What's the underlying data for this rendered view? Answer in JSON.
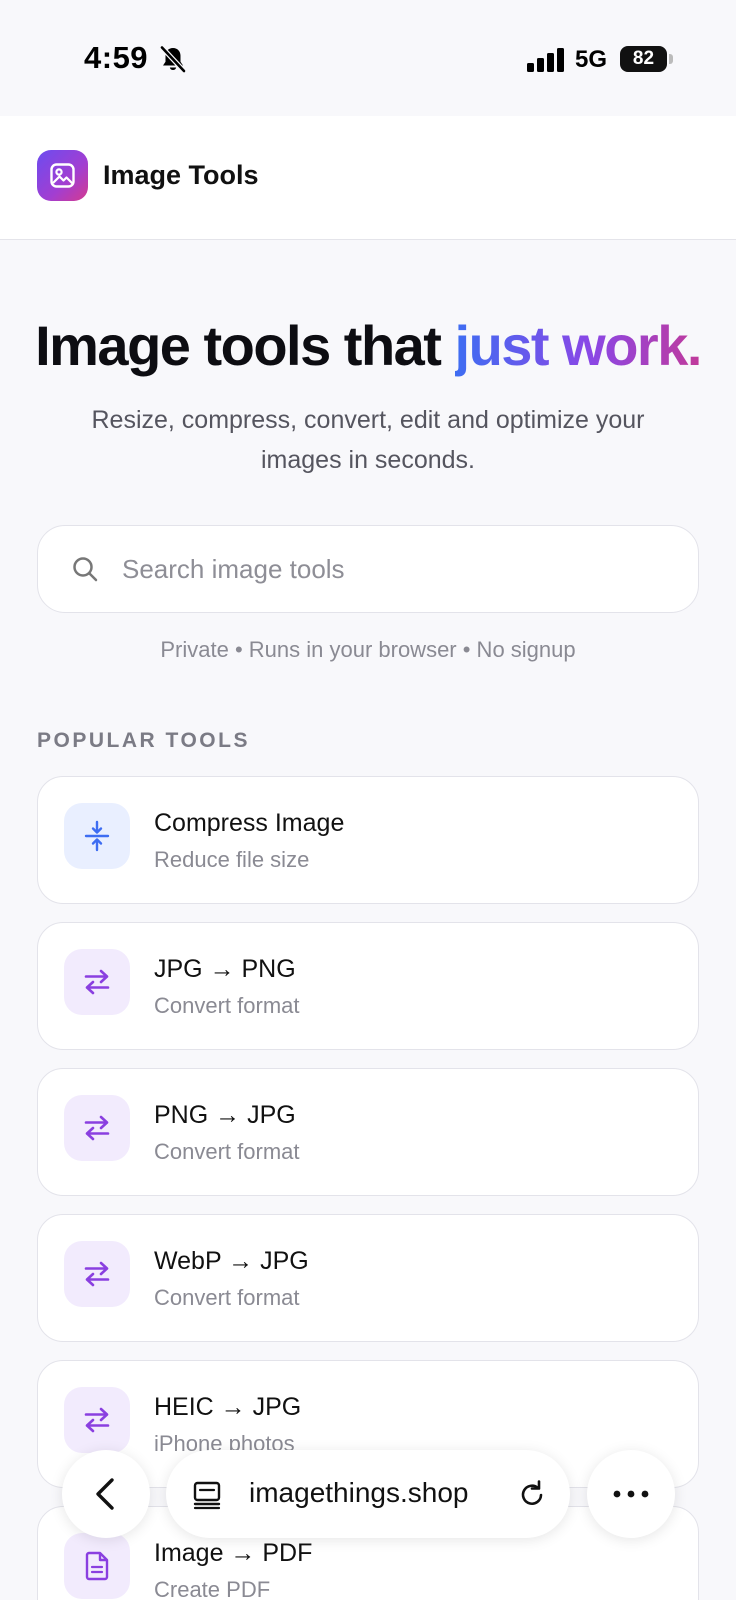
{
  "status_bar": {
    "time": "4:59",
    "network": "5G",
    "battery": "82",
    "icons": [
      "bell-slash-icon",
      "signal-icon",
      "battery-icon"
    ]
  },
  "header": {
    "brand": "Image Tools",
    "logo_icon": "image-icon",
    "logo_gradient": [
      "#6c4cf0",
      "#d43a8f"
    ]
  },
  "hero": {
    "title_main": "Image tools that ",
    "title_accent": "just work.",
    "accent_gradient": [
      "#3e6df2",
      "#8a47e6",
      "#c13a9a"
    ],
    "subtitle": "Resize, compress, convert, edit and optimize your images in seconds."
  },
  "search": {
    "placeholder": "Search image tools",
    "value": "",
    "icon": "search-icon"
  },
  "tagline": "Private • Runs in your browser • No signup",
  "popular": {
    "label": "POPULAR TOOLS",
    "tools": [
      {
        "title": "Compress Image",
        "subtitle": "Reduce file size",
        "icon": "compress-icon",
        "color": "#3e6df2"
      },
      {
        "title": "JPG → PNG",
        "subtitle": "Convert format",
        "icon": "convert-arrows-icon",
        "color": "#8a3fe0"
      },
      {
        "title": "PNG → JPG",
        "subtitle": "Convert format",
        "icon": "convert-arrows-icon",
        "color": "#8a3fe0"
      },
      {
        "title": "WebP → JPG",
        "subtitle": "Convert format",
        "icon": "convert-arrows-icon",
        "color": "#8a3fe0"
      },
      {
        "title": "HEIC → JPG",
        "subtitle": "iPhone photos",
        "icon": "convert-arrows-icon",
        "color": "#8a3fe0"
      },
      {
        "title": "Image → PDF",
        "subtitle": "Create PDF",
        "icon": "document-icon",
        "color": "#8a3fe0"
      }
    ]
  },
  "browser_bar": {
    "url": "imagethings.shop",
    "icons": [
      "back-icon",
      "page-icon",
      "reload-icon",
      "more-icon"
    ]
  }
}
